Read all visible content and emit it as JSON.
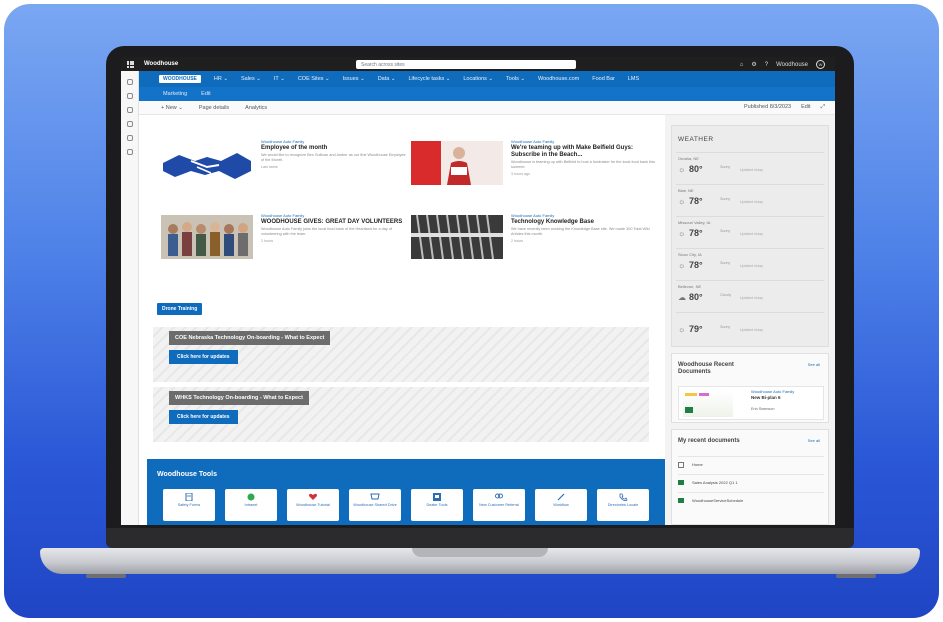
{
  "suite_bar": {
    "app_title": "Woodhouse",
    "search_placeholder": "Search across sites",
    "icons": [
      "chat-icon",
      "settings-icon",
      "help-icon"
    ],
    "user_label": "Woodhouse"
  },
  "hub_nav": {
    "logo": "WOODHOUSE",
    "items": [
      "HR ⌄",
      "Sales ⌄",
      "IT ⌄",
      "COE Sites ⌄",
      "Issues ⌄",
      "Data ⌄",
      "Lifecycle tasks ⌄",
      "Locations ⌄",
      "Tools ⌄",
      "Woodhouse.com",
      "Food Bar",
      "LMS"
    ]
  },
  "sub_nav": {
    "items": [
      "Marketing",
      "Edit"
    ]
  },
  "command_bar": {
    "items": [
      "+ New ⌄",
      "Page details",
      "Analytics"
    ],
    "right": [
      "Published 8/3/2023",
      "Edit",
      "⤢"
    ]
  },
  "news": [
    {
      "kicker": "Woodhouse Auto Family",
      "headline": "Employee of the month",
      "desc": "We would like to recognize Ben Sullivan and Amber as our first Woodhouse Employee of the Month.",
      "meta": "Last name"
    },
    {
      "kicker": "Woodhouse Auto Family",
      "headline": "We're teaming up with Make Belfield Guys: Subscribe in the Beach...",
      "desc": "Woodhouse is teaming up with Belfield to host a fundraiser for the local food bank this summer.",
      "meta": "3 hours ago"
    },
    {
      "kicker": "Woodhouse Auto Family",
      "headline": "WOODHOUSE GIVES: GREAT DAY VOLUNTEERS",
      "desc": "Woodhouse Auto Family joins the local food bank of the Heartland for a day of volunteering with the team.",
      "meta": "2 hours"
    },
    {
      "kicker": "Woodhouse Auto Family",
      "headline": "Technology Knowledge Base",
      "desc": "We have recently been working the Knowledge Base site. We made 300 Total Wiki Articles this month.",
      "meta": "2 hours"
    }
  ],
  "teleflex_button": "Drone Training",
  "banners": [
    {
      "title": "COE Nebraska Technology On-boarding - What to Expect",
      "button": "Click here for updates"
    },
    {
      "title": "WHKS Technology On-boarding - What to Expect",
      "button": "Click here for updates"
    }
  ],
  "tools": {
    "title": "Woodhouse Tools",
    "items": [
      {
        "label": "Safety Forms",
        "icon": "form-icon",
        "color": "#2c6db3"
      },
      {
        "label": "Intranet",
        "icon": "chat-icon",
        "color": "#2fa84f"
      },
      {
        "label": "Woodhouse Tutorial",
        "icon": "heart-icon",
        "color": "#d13438"
      },
      {
        "label": "Woodhouse Shared Drive",
        "icon": "cart-icon",
        "color": "#2c6db3"
      },
      {
        "label": "Dealer Tools",
        "icon": "tools-icon",
        "color": "#2c6db3"
      },
      {
        "label": "New Customer Referral",
        "icon": "people-icon",
        "color": "#2c6db3"
      },
      {
        "label": "Workflow",
        "icon": "link-icon",
        "color": "#2c6db3"
      },
      {
        "label": "Directories Locale",
        "icon": "phone-icon",
        "color": "#2c6db3"
      }
    ]
  },
  "weather": {
    "title": "WEATHER",
    "rows": [
      {
        "city": "Omaha, NE",
        "icon": "sun-icon",
        "temp": "80°",
        "cond": "Sunny",
        "extra": "Updated today"
      },
      {
        "city": "Blair, NE",
        "icon": "sun-icon",
        "temp": "78°",
        "cond": "Sunny",
        "extra": "Updated today"
      },
      {
        "city": "Missouri Valley, IA",
        "icon": "sun-icon",
        "temp": "78°",
        "cond": "Sunny",
        "extra": "Updated today"
      },
      {
        "city": "Sioux City, IA",
        "icon": "sun-icon",
        "temp": "78°",
        "cond": "Sunny",
        "extra": "Updated today"
      },
      {
        "city": "Bellevue, NE",
        "icon": "cloud-icon",
        "temp": "80°",
        "cond": "Cloudy",
        "extra": "Updated today"
      },
      {
        "city": "",
        "icon": "sun-icon",
        "temp": "79°",
        "cond": "Sunny",
        "extra": "Updated today"
      }
    ]
  },
  "recent_docs_card": {
    "title": "Woodhouse Recent Documents",
    "see_all": "See all",
    "doc_kicker": "Woodhouse Auto Family",
    "doc_name": "New Bi-plan 6",
    "doc_author": "Erin Swenson"
  },
  "my_recent": {
    "title": "My recent documents",
    "see_all": "See all",
    "rows": [
      {
        "icon": "home-icon",
        "label": "Home"
      },
      {
        "icon": "excel-icon",
        "label": "Sales Analysis 2022 Q1 1"
      },
      {
        "icon": "excel-icon",
        "label": "WoodhouseServiceSchedule"
      }
    ]
  }
}
